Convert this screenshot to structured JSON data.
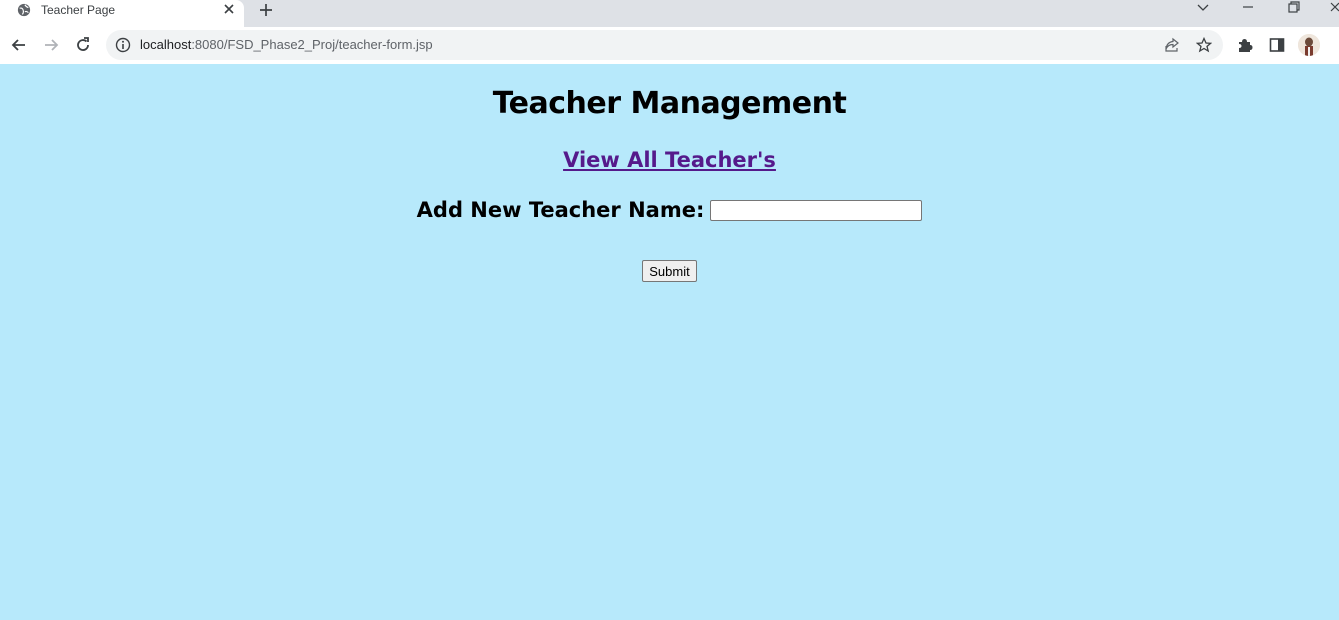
{
  "browser": {
    "tab_title": "Teacher Page",
    "url_host": "localhost",
    "url_rest": ":8080/FSD_Phase2_Proj/teacher-form.jsp",
    "icons": [
      "globe-icon",
      "close-icon",
      "plus-icon",
      "chevron-down-icon",
      "minimize-icon",
      "restore-icon",
      "back-icon",
      "forward-icon",
      "reload-icon",
      "info-icon",
      "share-icon",
      "star-icon",
      "puzzle-icon",
      "sidepanel-icon"
    ]
  },
  "page": {
    "heading": "Teacher Management",
    "view_link": "View All Teacher's",
    "form_label": "Add New Teacher Name:",
    "name_value": "",
    "submit_label": "Submit",
    "background_color": "#b7e9fb",
    "link_color": "#551a8b"
  }
}
